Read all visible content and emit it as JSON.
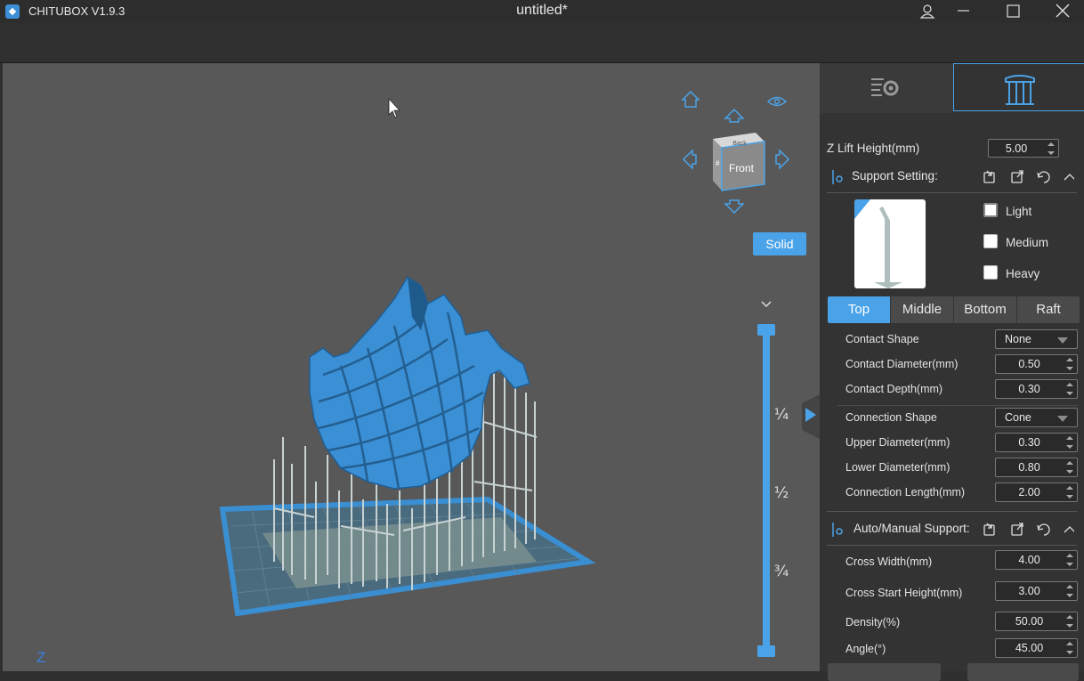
{
  "titlebar": {
    "app_name": "CHITUBOX V1.9.3",
    "doc_title": "untitled*",
    "icons": [
      "user-icon",
      "minimize-icon",
      "maximize-icon",
      "close-icon"
    ]
  },
  "viewport": {
    "view_mode_button": "Solid",
    "cube_face_label": "Front",
    "cube_top_label": "Back",
    "cube_left_label": "#",
    "axis_label": "Z",
    "slider_marks": [
      "¼",
      "½",
      "¾"
    ],
    "slider_value": 1.0,
    "colors": {
      "model": "#3b8fd4",
      "support": "#c8d2d2",
      "platform": "#3a8ed2",
      "accent": "#4aa3e8"
    }
  },
  "panel": {
    "tabs": [
      {
        "name": "settings-tab",
        "icon": "settings-list-icon",
        "active": false
      },
      {
        "name": "support-tab",
        "icon": "support-pillar-icon",
        "active": true
      }
    ],
    "z_lift": {
      "label": "Z Lift Height(mm)",
      "value": "5.00"
    },
    "support_setting": {
      "title": "Support Setting:",
      "presets": [
        {
          "label": "Light",
          "checked": false,
          "focused": true
        },
        {
          "label": "Medium",
          "checked": false
        },
        {
          "label": "Heavy",
          "checked": false
        }
      ]
    },
    "segments": [
      "Top",
      "Middle",
      "Bottom",
      "Raft"
    ],
    "active_segment": "Top",
    "top_rows": [
      {
        "label": "Contact Shape",
        "type": "combo",
        "value": "None"
      },
      {
        "label": "Contact Diameter(mm)",
        "type": "spin",
        "value": "0.50"
      },
      {
        "label": "Contact Depth(mm)",
        "type": "spin",
        "value": "0.30"
      },
      {
        "label": "Connection Shape",
        "type": "combo",
        "value": "Cone"
      },
      {
        "label": "Upper Diameter(mm)",
        "type": "spin",
        "value": "0.30"
      },
      {
        "label": "Lower Diameter(mm)",
        "type": "spin",
        "value": "0.80"
      },
      {
        "label": "Connection Length(mm)",
        "type": "spin",
        "value": "2.00"
      }
    ],
    "auto_manual": {
      "title": "Auto/Manual Support:",
      "rows": [
        {
          "label": "Cross Width(mm)",
          "value": "4.00"
        },
        {
          "label": "Cross Start Height(mm)",
          "value": "3.00"
        },
        {
          "label": "Density(%)",
          "value": "50.00"
        },
        {
          "label": "Angle(°)",
          "value": "45.00"
        }
      ]
    }
  }
}
